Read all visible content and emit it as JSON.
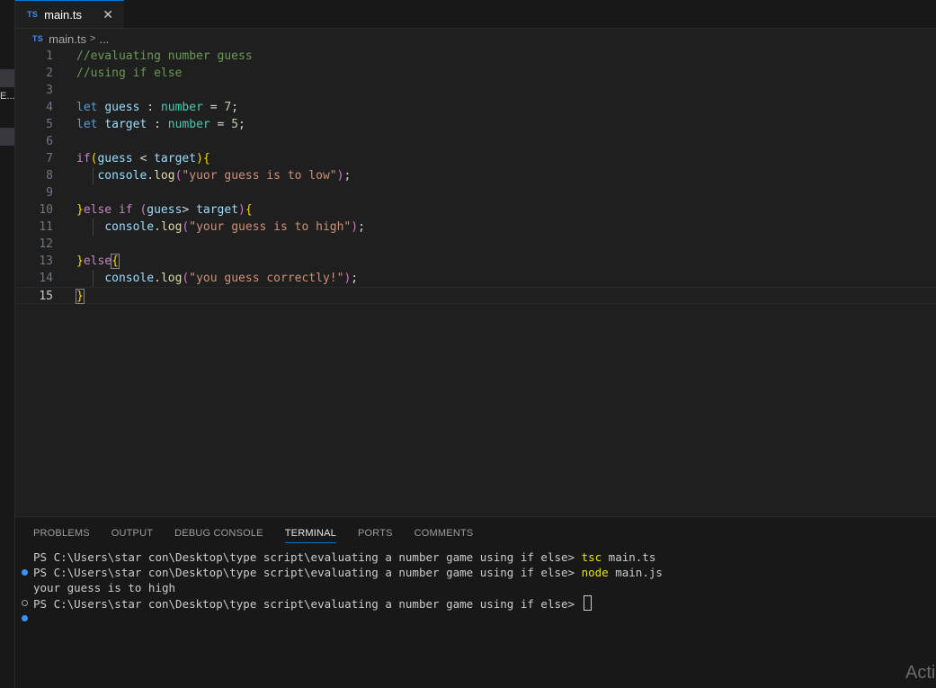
{
  "sidebar": {
    "truncated_label": "E..."
  },
  "tab": {
    "icon": "TS",
    "label": "main.ts",
    "close": "✕"
  },
  "breadcrumb": {
    "icon": "TS",
    "file": "main.ts",
    "separator": ">",
    "more": "..."
  },
  "editor": {
    "lines": [
      {
        "num": "1",
        "tokens": [
          {
            "t": "//evaluating number guess",
            "c": "com"
          }
        ]
      },
      {
        "num": "2",
        "tokens": [
          {
            "t": "//using if else",
            "c": "com"
          }
        ]
      },
      {
        "num": "3",
        "tokens": []
      },
      {
        "num": "4",
        "tokens": [
          {
            "t": "let",
            "c": "kw"
          },
          {
            "t": " ",
            "c": "plain"
          },
          {
            "t": "guess",
            "c": "var"
          },
          {
            "t": " : ",
            "c": "plain"
          },
          {
            "t": "number",
            "c": "type"
          },
          {
            "t": " = ",
            "c": "plain"
          },
          {
            "t": "7",
            "c": "num"
          },
          {
            "t": ";",
            "c": "plain"
          }
        ]
      },
      {
        "num": "5",
        "tokens": [
          {
            "t": "let",
            "c": "kw"
          },
          {
            "t": " ",
            "c": "plain"
          },
          {
            "t": "target",
            "c": "var"
          },
          {
            "t": " : ",
            "c": "plain"
          },
          {
            "t": "number",
            "c": "type"
          },
          {
            "t": " = ",
            "c": "plain"
          },
          {
            "t": "5",
            "c": "num"
          },
          {
            "t": ";",
            "c": "plain"
          }
        ]
      },
      {
        "num": "6",
        "tokens": []
      },
      {
        "num": "7",
        "tokens": [
          {
            "t": "if",
            "c": "ctl"
          },
          {
            "t": "(",
            "c": "b1"
          },
          {
            "t": "guess",
            "c": "var"
          },
          {
            "t": " < ",
            "c": "plain"
          },
          {
            "t": "target",
            "c": "var"
          },
          {
            "t": ")",
            "c": "b1"
          },
          {
            "t": "{",
            "c": "b1"
          }
        ]
      },
      {
        "num": "8",
        "tokens": [
          {
            "t": "   ",
            "c": "plain"
          },
          {
            "t": "console",
            "c": "var"
          },
          {
            "t": ".",
            "c": "plain"
          },
          {
            "t": "log",
            "c": "fn"
          },
          {
            "t": "(",
            "c": "b2"
          },
          {
            "t": "\"yuor guess is to low\"",
            "c": "str"
          },
          {
            "t": ")",
            "c": "b2"
          },
          {
            "t": ";",
            "c": "plain"
          }
        ]
      },
      {
        "num": "9",
        "tokens": []
      },
      {
        "num": "10",
        "tokens": [
          {
            "t": "}",
            "c": "b1"
          },
          {
            "t": "else",
            "c": "ctl"
          },
          {
            "t": " ",
            "c": "plain"
          },
          {
            "t": "if",
            "c": "ctl"
          },
          {
            "t": " ",
            "c": "plain"
          },
          {
            "t": "(",
            "c": "b2"
          },
          {
            "t": "guess",
            "c": "var"
          },
          {
            "t": "> ",
            "c": "plain"
          },
          {
            "t": "target",
            "c": "var"
          },
          {
            "t": ")",
            "c": "b2"
          },
          {
            "t": "{",
            "c": "b1"
          }
        ]
      },
      {
        "num": "11",
        "tokens": [
          {
            "t": "    ",
            "c": "plain"
          },
          {
            "t": "console",
            "c": "var"
          },
          {
            "t": ".",
            "c": "plain"
          },
          {
            "t": "log",
            "c": "fn"
          },
          {
            "t": "(",
            "c": "b2"
          },
          {
            "t": "\"your guess is to high\"",
            "c": "str"
          },
          {
            "t": ")",
            "c": "b2"
          },
          {
            "t": ";",
            "c": "plain"
          }
        ]
      },
      {
        "num": "12",
        "tokens": []
      },
      {
        "num": "13",
        "tokens": [
          {
            "t": "}",
            "c": "b1"
          },
          {
            "t": "else",
            "c": "ctl"
          },
          {
            "t": "{",
            "c": "b1",
            "hl": true
          }
        ]
      },
      {
        "num": "14",
        "tokens": [
          {
            "t": "    ",
            "c": "plain"
          },
          {
            "t": "console",
            "c": "var"
          },
          {
            "t": ".",
            "c": "plain"
          },
          {
            "t": "log",
            "c": "fn"
          },
          {
            "t": "(",
            "c": "b2"
          },
          {
            "t": "\"you guess correctly!\"",
            "c": "str"
          },
          {
            "t": ")",
            "c": "b2"
          },
          {
            "t": ";",
            "c": "plain"
          }
        ]
      },
      {
        "num": "15",
        "tokens": [
          {
            "t": "}",
            "c": "b1",
            "hl": true
          }
        ],
        "active": true
      }
    ]
  },
  "panel": {
    "tabs": [
      {
        "label": "PROBLEMS",
        "active": false
      },
      {
        "label": "OUTPUT",
        "active": false
      },
      {
        "label": "DEBUG CONSOLE",
        "active": false
      },
      {
        "label": "TERMINAL",
        "active": true
      },
      {
        "label": "PORTS",
        "active": false
      },
      {
        "label": "COMMENTS",
        "active": false
      }
    ]
  },
  "terminal": {
    "lines": [
      {
        "dot": "none",
        "prompt": "PS C:\\Users\\star con\\Desktop\\type script\\evaluating a number game using if else> ",
        "cmd": "tsc",
        "args": " main.ts"
      },
      {
        "dot": "filled",
        "prompt": "PS C:\\Users\\star con\\Desktop\\type script\\evaluating a number game using if else> ",
        "cmd": "node",
        "args": " main.js"
      },
      {
        "dot": "none",
        "prompt": "your guess is to high",
        "cmd": "",
        "args": ""
      },
      {
        "dot": "hollow",
        "prompt": "PS C:\\Users\\star con\\Desktop\\type script\\evaluating a number game using if else> ",
        "cmd": "",
        "args": "",
        "cursor": true
      },
      {
        "dot": "filled",
        "prompt": "",
        "cmd": "",
        "args": ""
      }
    ]
  },
  "watermark": {
    "text": "Acti"
  }
}
